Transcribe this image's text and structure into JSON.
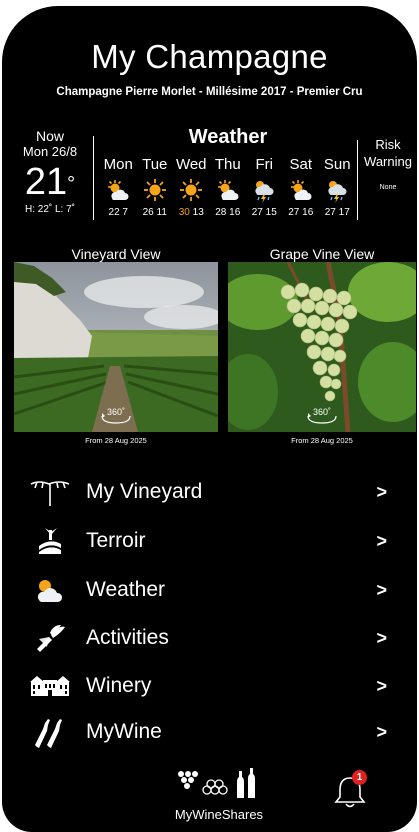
{
  "app": {
    "title": "My Champagne",
    "subtitle": "Champagne Pierre Morlet - Millésime 2017 - Premier Cru"
  },
  "now": {
    "label": "Now",
    "date": "Mon 26/8",
    "temp": "21",
    "degree": "°",
    "hilo": "H: 22˚  L: 7˚"
  },
  "weather": {
    "heading": "Weather",
    "days": [
      {
        "name": "Mon",
        "icon": "partly-sunny-icon",
        "hi": "22",
        "lo": "7",
        "hi_warm": false
      },
      {
        "name": "Tue",
        "icon": "sun-icon",
        "hi": "26",
        "lo": "11",
        "hi_warm": false
      },
      {
        "name": "Wed",
        "icon": "sun-icon",
        "hi": "30",
        "lo": "13",
        "hi_warm": true
      },
      {
        "name": "Thu",
        "icon": "partly-sunny-icon",
        "hi": "28",
        "lo": "16",
        "hi_warm": false
      },
      {
        "name": "Fri",
        "icon": "storm-icon",
        "hi": "27",
        "lo": "15",
        "hi_warm": false
      },
      {
        "name": "Sat",
        "icon": "partly-sunny-icon",
        "hi": "27",
        "lo": "16",
        "hi_warm": false
      },
      {
        "name": "Sun",
        "icon": "storm-icon",
        "hi": "27",
        "lo": "17",
        "hi_warm": false
      }
    ]
  },
  "risk": {
    "label": "Risk Warning",
    "value": "None"
  },
  "views": {
    "vineyard": {
      "label": "Vineyard View",
      "badge": "360˚",
      "from": "From 28 Aug 2025"
    },
    "grape": {
      "label": "Grape Vine View",
      "badge": "360˚",
      "from": "From 28 Aug 2025"
    }
  },
  "menu": [
    {
      "label": "My Vineyard",
      "icon": "vine-icon",
      "chevron": ">"
    },
    {
      "label": "Terroir",
      "icon": "terroir-icon",
      "chevron": ">"
    },
    {
      "label": "Weather",
      "icon": "cloud-sun-icon",
      "chevron": ">"
    },
    {
      "label": "Activities",
      "icon": "pruning-shears-icon",
      "chevron": ">"
    },
    {
      "label": "Winery",
      "icon": "winery-building-icon",
      "chevron": ">"
    },
    {
      "label": "MyWine",
      "icon": "wine-bottles-icon",
      "chevron": ">"
    }
  ],
  "shares": {
    "label": "MyWineShares"
  },
  "notifications": {
    "count": "1"
  },
  "colors": {
    "background": "#000000",
    "warm_temp": "#ff9d1c",
    "badge": "#e32020"
  }
}
